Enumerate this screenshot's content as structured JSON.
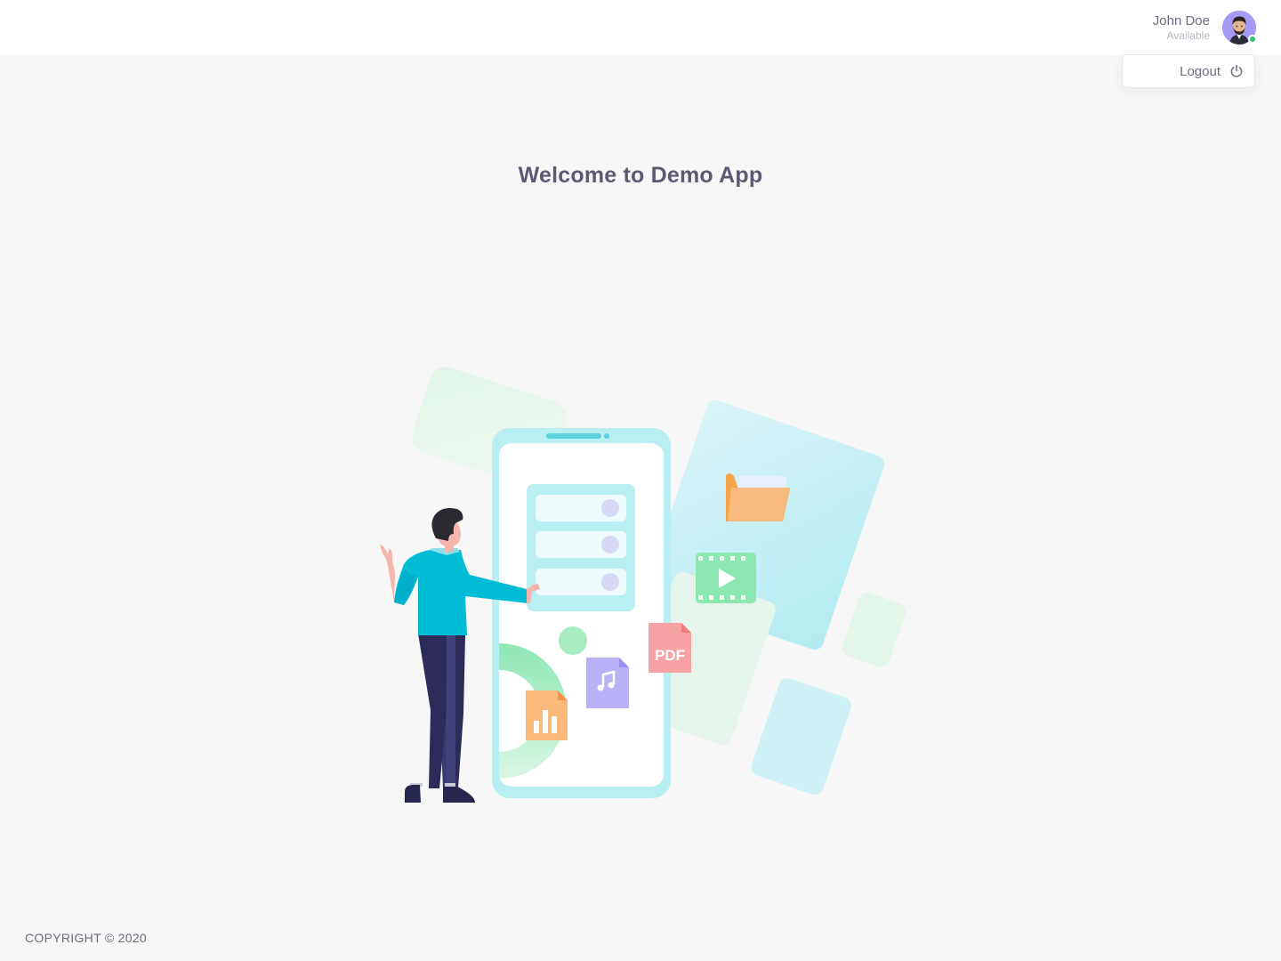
{
  "header": {
    "user_name": "John Doe",
    "user_status": "Available",
    "avatar_icon": "user-avatar",
    "status_color": "#28c76f"
  },
  "dropdown": {
    "logout_label": "Logout",
    "logout_icon": "power-icon"
  },
  "main": {
    "welcome_title": "Welcome to Demo App",
    "illustration_pdf_label": "PDF"
  },
  "footer": {
    "copyright": "COPYRIGHT © 2020"
  },
  "colors": {
    "background": "#f7f7f7",
    "header": "#ffffff",
    "text": "#5e5873"
  }
}
